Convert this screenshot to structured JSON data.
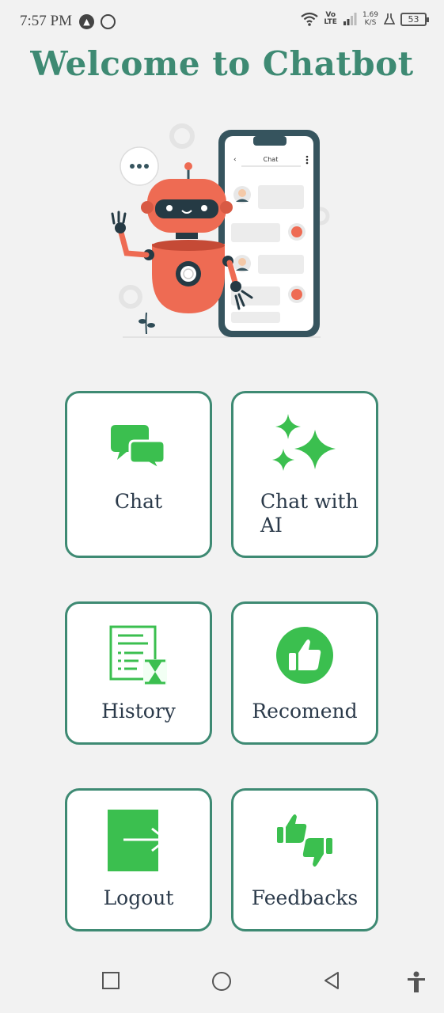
{
  "status_bar": {
    "time": "7:57 PM",
    "network_label_top": "Vo",
    "network_label_bottom": "LTE",
    "speed_value": "1.69",
    "speed_unit": "K/S",
    "battery": "53"
  },
  "title": "Welcome to Chatbot",
  "hero": {
    "phone_header": "Chat"
  },
  "menu": {
    "chat": "Chat",
    "chat_ai_line1": "Chat with",
    "chat_ai_line2": "AI",
    "history": "History",
    "recommend": "Recomend",
    "logout": "Logout",
    "feedbacks": "Feedbacks"
  },
  "colors": {
    "accent": "#3e8a73",
    "icon_green": "#3bbf4f",
    "robot": "#ee6b53",
    "background": "#f2f2f2"
  }
}
